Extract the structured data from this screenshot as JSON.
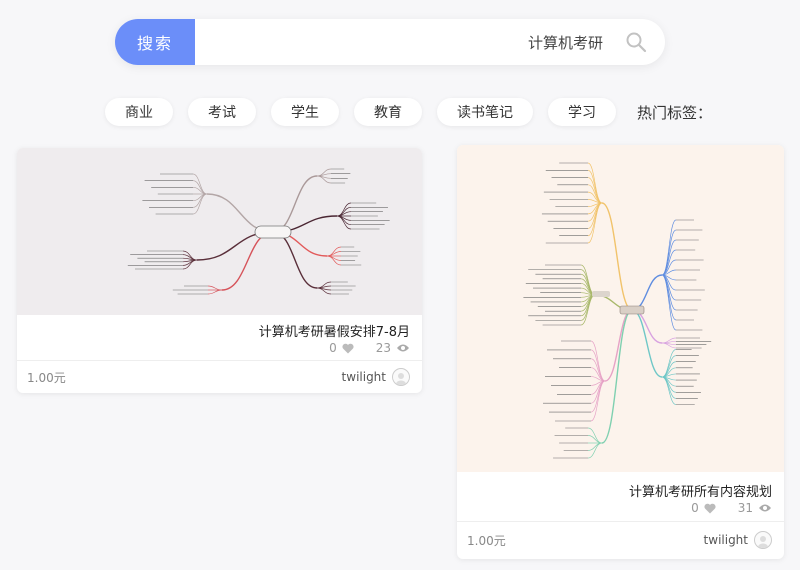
{
  "search": {
    "button_label": "搜索",
    "query": "计算机考研"
  },
  "tags": {
    "title": "热门标签：",
    "items": [
      "学习",
      "读书笔记",
      "教育",
      "学生",
      "考试",
      "商业"
    ]
  },
  "cards": [
    {
      "title": "计算机考研暑假安排7-8月",
      "views": "23",
      "likes": "0",
      "author": "twilight",
      "price": "1.00元"
    },
    {
      "title": "计算机考研所有内容规划",
      "views": "31",
      "likes": "0",
      "author": "twilight",
      "price": "1.00元"
    }
  ],
  "colors": {
    "accent": "#6b8ef9",
    "page_bg": "#f7f7f9"
  }
}
